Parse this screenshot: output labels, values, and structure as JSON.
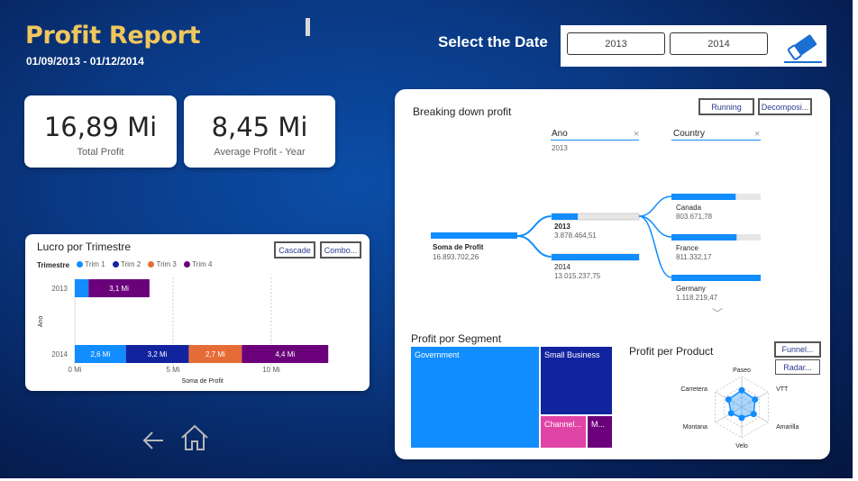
{
  "header": {
    "title": "Profit Report",
    "date_range": "01/09/2013 - 01/12/2014",
    "select_label": "Select the Date",
    "year_options": [
      "2013",
      "2014"
    ]
  },
  "kpis": [
    {
      "value": "16,89 Mi",
      "label": "Total Profit"
    },
    {
      "value": "8,45 Mi",
      "label": "Average Profit - Year"
    }
  ],
  "quarter_chart": {
    "title": "Lucro por Trimestre",
    "buttons": [
      "Cascade",
      "Combo..."
    ],
    "legend_title": "Trimestre",
    "legend": [
      {
        "name": "Trim 1",
        "color": "#118DFF"
      },
      {
        "name": "Trim 2",
        "color": "#12239E"
      },
      {
        "name": "Trim 3",
        "color": "#E66C37"
      },
      {
        "name": "Trim 4",
        "color": "#6B007B"
      }
    ],
    "y_axis_label": "Ano",
    "x_axis_label": "Soma de Profit",
    "x_ticks": [
      "0 Mi",
      "5 Mi",
      "10 Mi"
    ]
  },
  "chart_data": {
    "type": "bar",
    "orientation": "horizontal-stacked",
    "categories": [
      "2013",
      "2014"
    ],
    "series": [
      {
        "name": "Trim 1",
        "values": [
          0.7,
          2.6
        ],
        "labels": [
          "",
          "2,6 Mi"
        ]
      },
      {
        "name": "Trim 2",
        "values": [
          0,
          3.2
        ],
        "labels": [
          "",
          "3,2 Mi"
        ]
      },
      {
        "name": "Trim 3",
        "values": [
          0,
          2.7
        ],
        "labels": [
          "",
          "2,7 Mi"
        ]
      },
      {
        "name": "Trim 4",
        "values": [
          3.1,
          4.4
        ],
        "labels": [
          "3,1 Mi",
          "4,4 Mi"
        ]
      }
    ],
    "xlim": [
      0,
      13
    ],
    "xlabel": "Soma de Profit",
    "ylabel": "Ano"
  },
  "decomp": {
    "title": "Breaking down profit",
    "buttons": [
      "Running",
      "Decomposi..."
    ],
    "col_ano": "Ano",
    "col_ano_sub": "2013",
    "col_country": "Country",
    "root_label": "Soma de Profit",
    "root_value": "16.893.702,26",
    "years": [
      {
        "label": "2013",
        "value": "3.878.464,51",
        "fill": 0.3
      },
      {
        "label": "2014",
        "value": "13.015.237,75",
        "fill": 1.0
      }
    ],
    "countries": [
      {
        "label": "Canada",
        "value": "803.671,78",
        "fill": 0.72
      },
      {
        "label": "France",
        "value": "811.332,17",
        "fill": 0.73
      },
      {
        "label": "Germany",
        "value": "1.118.219,47",
        "fill": 1.0
      }
    ]
  },
  "segment": {
    "title": "Profit por Segment",
    "tiles": [
      "Government",
      "Small Business",
      "Channel...",
      "M..."
    ]
  },
  "product": {
    "title": "Profit per Product",
    "buttons": [
      "Funnel...",
      "Radar..."
    ],
    "axes": [
      "Paseo",
      "VTT",
      "Amarilla",
      "Velo",
      "Montana",
      "Carretera"
    ],
    "values": [
      0.55,
      0.5,
      0.45,
      0.35,
      0.4,
      0.5
    ]
  },
  "nav": {
    "back": "back-arrow-icon",
    "home": "home-icon"
  }
}
